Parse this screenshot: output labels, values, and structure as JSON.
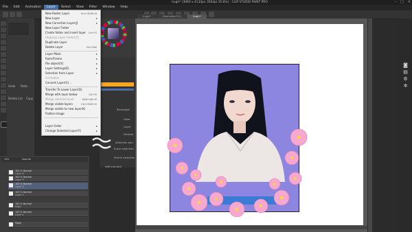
{
  "window": {
    "title": "hugh* (3060 x 4134px 350dpi 35.6%) - CLIP STUDIO PAINT PRO",
    "controls": [
      "–",
      "□",
      "✕"
    ]
  },
  "menu": [
    "File",
    "Edit",
    "Animation",
    "Layer",
    "Select",
    "View",
    "Filter",
    "Window",
    "Help"
  ],
  "tabs": [
    "hugh*",
    "Illustration*(1)",
    "hugh*"
  ],
  "subtool": {
    "rows": [
      "Undo",
      "Redo",
      "Delete",
      "Cut",
      "Copy"
    ]
  },
  "layer_menu": [
    {
      "label": "New Raster Layer",
      "shortcut": "Ctrl+Shift+N"
    },
    {
      "label": "New Layer",
      "arrow": true
    },
    {
      "label": "New Correction Layer(J)",
      "arrow": true
    },
    {
      "label": "New Layer Folder",
      "shortcut": ""
    },
    {
      "label": "Create folder and insert layer",
      "shortcut": "Ctrl+G"
    },
    {
      "label": "Ungroup Layer Folder(Y)",
      "disabled": true
    },
    {
      "label": "Duplicate Layer"
    },
    {
      "label": "Delete Layer",
      "shortcut": "Ctrl+Del"
    },
    {
      "sep": true
    },
    {
      "label": "Layer Mask",
      "arrow": true
    },
    {
      "label": "Ruler/Frame",
      "arrow": true
    },
    {
      "label": "File object(X)",
      "arrow": true
    },
    {
      "label": "Layer Settings(E)",
      "arrow": true
    },
    {
      "label": "Selection from Layer",
      "arrow": true
    },
    {
      "label": "Animation",
      "disabled": true
    },
    {
      "label": "Convert Layer(V)..."
    },
    {
      "sep": true
    },
    {
      "label": "Transfer To Lower Layer(Q)"
    },
    {
      "label": "Merge with layer below",
      "shortcut": "Ctrl+E"
    },
    {
      "label": "Merge selected layer",
      "disabled": true,
      "shortcut": "Shift+Alt+E"
    },
    {
      "label": "Merge visible layers",
      "shortcut": "Ctrl+Shift+E"
    },
    {
      "label": "Merge visible to new layer(K)",
      "shortcut": ""
    },
    {
      "label": "Flatten image"
    },
    {
      "sep": true
    },
    {
      "label": "Layer Order",
      "arrow": true
    },
    {
      "label": "Change Selected Layer(Y)",
      "arrow": true
    }
  ],
  "tool_property": {
    "rows": [
      "Rectangle",
      "Glow",
      "Layer",
      "Finisher",
      "Selection pen",
      "Erase selection",
      "Shrink selection",
      "Add sub tool"
    ]
  },
  "layers": [
    {
      "name": "100 % Normal",
      "sub": "Layer 4"
    },
    {
      "name": "100 % Normal",
      "sub": "Layer 9"
    },
    {
      "name": "100 % Normal",
      "sub": "Layer 3",
      "selected": true
    },
    {
      "name": "100 % Normal",
      "sub": "Layer 2"
    },
    {
      "name": "100 % Normal",
      "sub": "hugh"
    },
    {
      "name": "100 % Normal",
      "sub": "Layer 1"
    },
    {
      "name": "Paper",
      "sub": ""
    }
  ],
  "layer_header": {
    "blend": "Normal",
    "opacity": "100"
  },
  "colors": {
    "accent": "#4a6fa5",
    "artbg": "#8c86e0"
  }
}
